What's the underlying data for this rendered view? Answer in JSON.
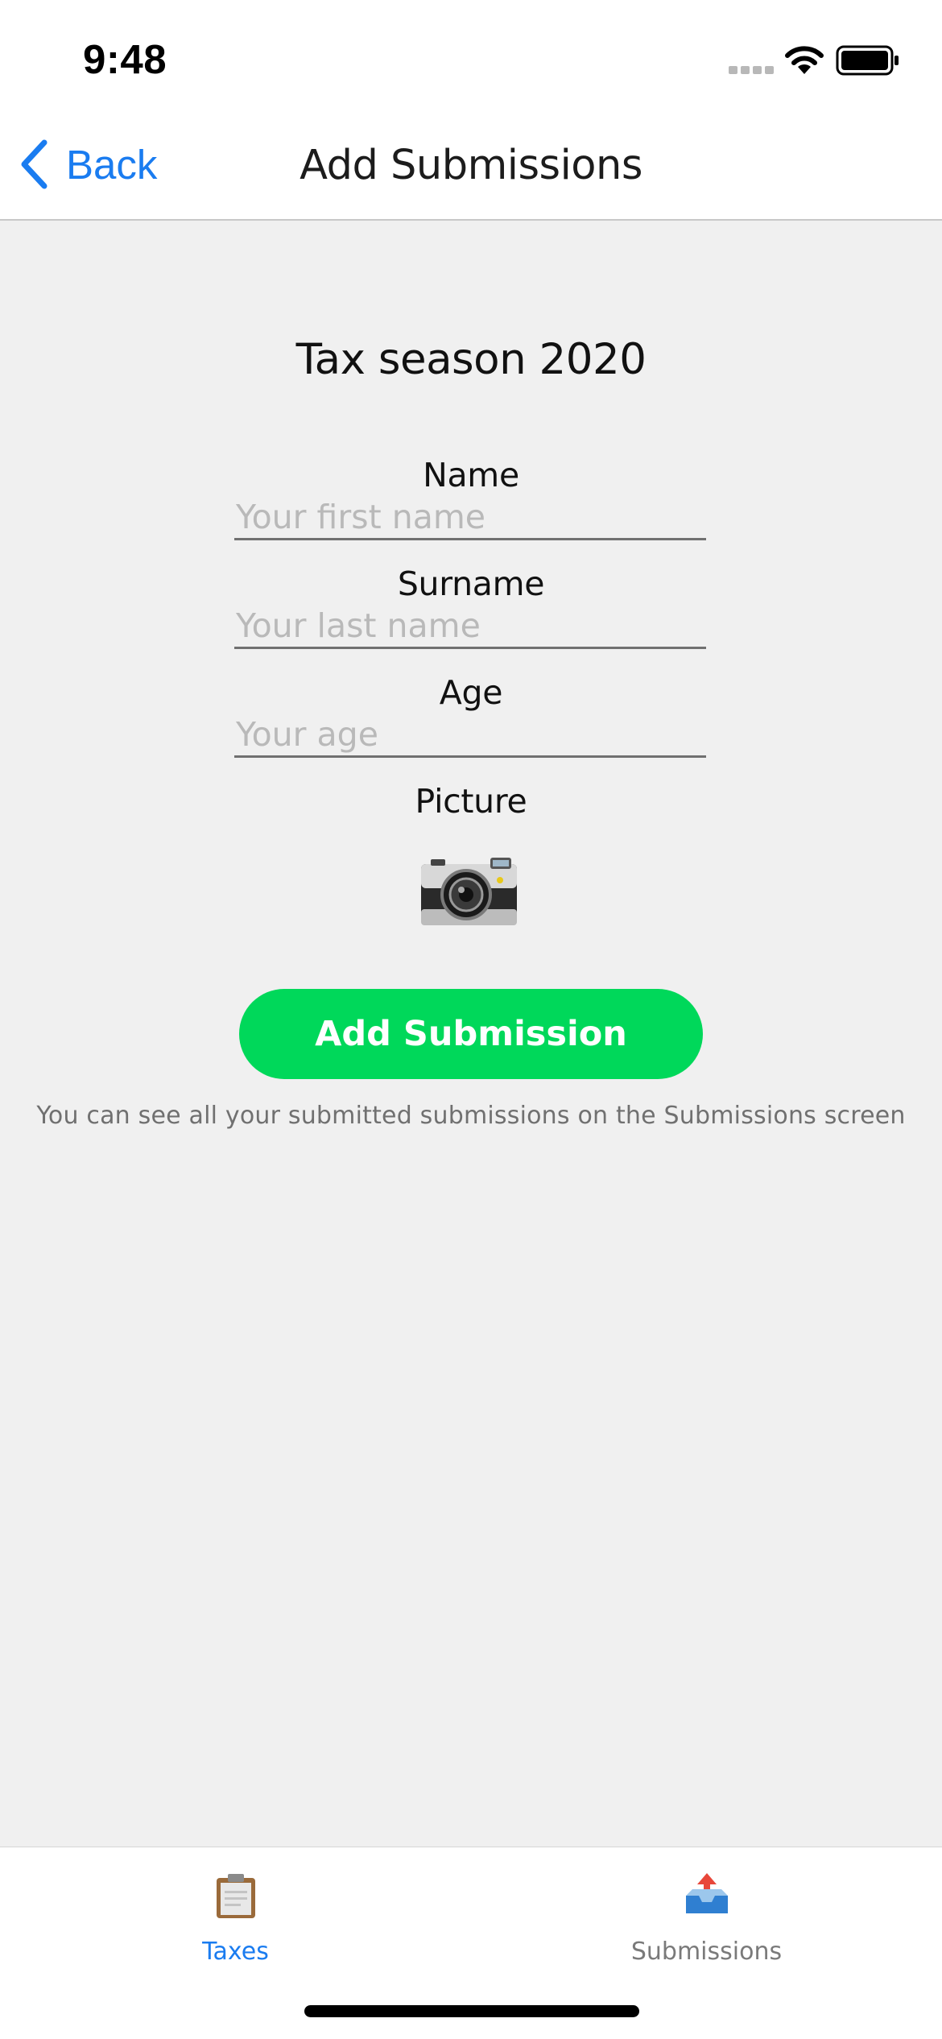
{
  "status_bar": {
    "time": "9:48"
  },
  "nav": {
    "back_label": "Back",
    "title": "Add Submissions"
  },
  "form": {
    "title": "Tax season 2020",
    "fields": [
      {
        "label": "Name",
        "placeholder": "Your first name",
        "value": ""
      },
      {
        "label": "Surname",
        "placeholder": "Your last name",
        "value": ""
      },
      {
        "label": "Age",
        "placeholder": "Your age",
        "value": ""
      }
    ],
    "picture_label": "Picture",
    "picture_icon": "camera-icon",
    "submit_label": "Add Submission",
    "hint": "You can see all your submitted submissions on the Submissions screen"
  },
  "tabs": [
    {
      "label": "Taxes",
      "icon": "clipboard-icon",
      "active": true
    },
    {
      "label": "Submissions",
      "icon": "outbox-tray-icon",
      "active": false
    }
  ],
  "colors": {
    "accent": "#1a7cf0",
    "submit_button": "#00d85a",
    "background": "#f0f0f0",
    "inactive_tab": "#7a7a7a"
  }
}
